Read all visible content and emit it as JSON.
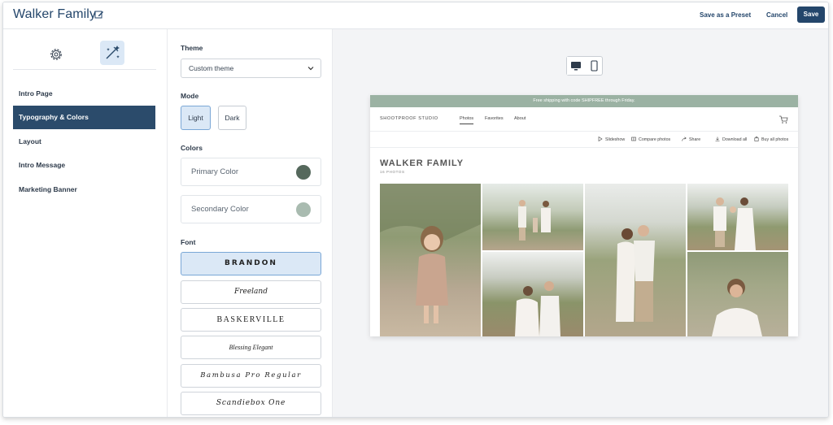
{
  "header": {
    "title": "Walker Family",
    "save_preset_label": "Save as a Preset",
    "cancel_label": "Cancel",
    "save_label": "Save"
  },
  "sidebar": {
    "items": [
      {
        "label": "Intro Page"
      },
      {
        "label": "Typography & Colors"
      },
      {
        "label": "Layout"
      },
      {
        "label": "Intro Message"
      },
      {
        "label": "Marketing Banner"
      }
    ]
  },
  "panel": {
    "theme_label": "Theme",
    "theme_value": "Custom theme",
    "mode_label": "Mode",
    "mode_light": "Light",
    "mode_dark": "Dark",
    "colors_label": "Colors",
    "primary_color_label": "Primary Color",
    "primary_color": "#55685c",
    "secondary_color_label": "Secondary Color",
    "secondary_color": "#a9bbb0",
    "font_label": "Font",
    "fonts": [
      "BRANDON",
      "Freeland",
      "BASKERVILLE",
      "Blessing Elegant",
      "Bambusa Pro Regular",
      "Scandiebox One"
    ]
  },
  "preview": {
    "announcement": "Free shipping with code SHIPFREE through Friday.",
    "studio_name": "SHOOTPROOF STUDIO",
    "nav": [
      "Photos",
      "Favorites",
      "About"
    ],
    "actions": [
      "Slideshow",
      "Compare photos",
      "Share",
      "Download all",
      "Buy all photos"
    ],
    "gallery_title": "WALKER FAMILY",
    "gallery_count": "16 PHOTOS"
  },
  "colors": {
    "accent": "#24466b",
    "active_nav": "#2b4b6b",
    "selected_bg": "#dbe8f6"
  }
}
